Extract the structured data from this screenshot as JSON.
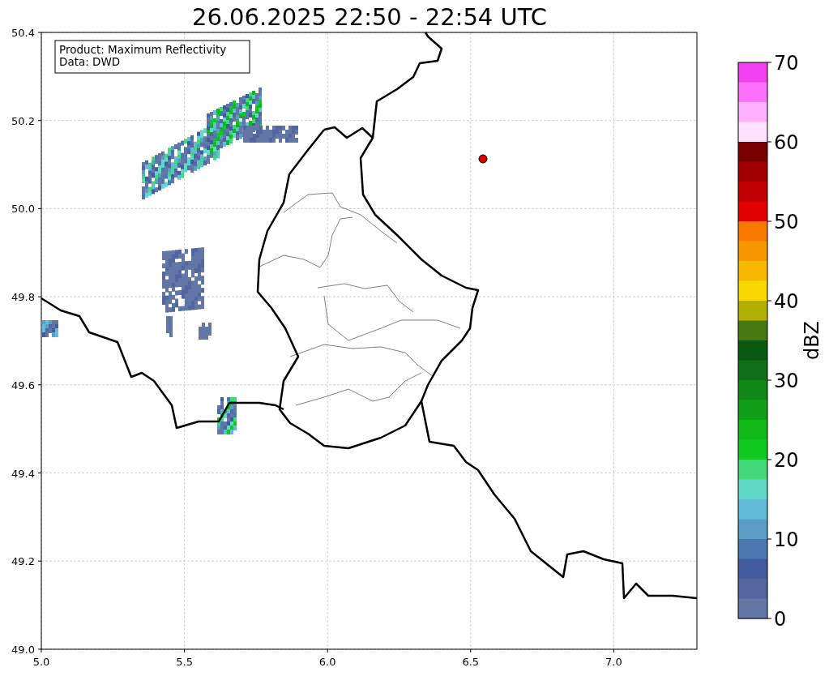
{
  "title": "26.06.2025 22:50 - 22:54 UTC",
  "info_box": {
    "lines": [
      "Product: Maximum Reflectivity",
      "Data: DWD"
    ]
  },
  "map": {
    "x_ticks": [
      "5.0",
      "5.5",
      "6.0",
      "6.5",
      "7.0"
    ],
    "y_ticks": [
      "50.4",
      "50.2",
      "50.0",
      "49.8",
      "49.6",
      "49.4",
      "49.2",
      "49.0"
    ]
  },
  "colorbar": {
    "label": "dBZ",
    "ticks": [
      "70",
      "60",
      "50",
      "40",
      "30",
      "20",
      "10",
      "0"
    ],
    "bins": [
      {
        "color": "#f040f0"
      },
      {
        "color": "#ff70ff"
      },
      {
        "color": "#ffb0ff"
      },
      {
        "color": "#ffe0ff"
      },
      {
        "color": "#780000"
      },
      {
        "color": "#a00000"
      },
      {
        "color": "#c00000"
      },
      {
        "color": "#e00000"
      },
      {
        "color": "#f87800"
      },
      {
        "color": "#f89800"
      },
      {
        "color": "#f8b800"
      },
      {
        "color": "#f8d800"
      },
      {
        "color": "#b0b000"
      },
      {
        "color": "#4a7810"
      },
      {
        "color": "#085810"
      },
      {
        "color": "#107018"
      },
      {
        "color": "#108818"
      },
      {
        "color": "#10a018"
      },
      {
        "color": "#10b818"
      },
      {
        "color": "#10c820"
      },
      {
        "color": "#40d878"
      },
      {
        "color": "#60d8c8"
      },
      {
        "color": "#60bcd8"
      },
      {
        "color": "#5a9ec8"
      },
      {
        "color": "#4a78b0"
      },
      {
        "color": "#435c9e"
      },
      {
        "color": "#5366a0"
      },
      {
        "color": "#6377a6"
      }
    ]
  }
}
